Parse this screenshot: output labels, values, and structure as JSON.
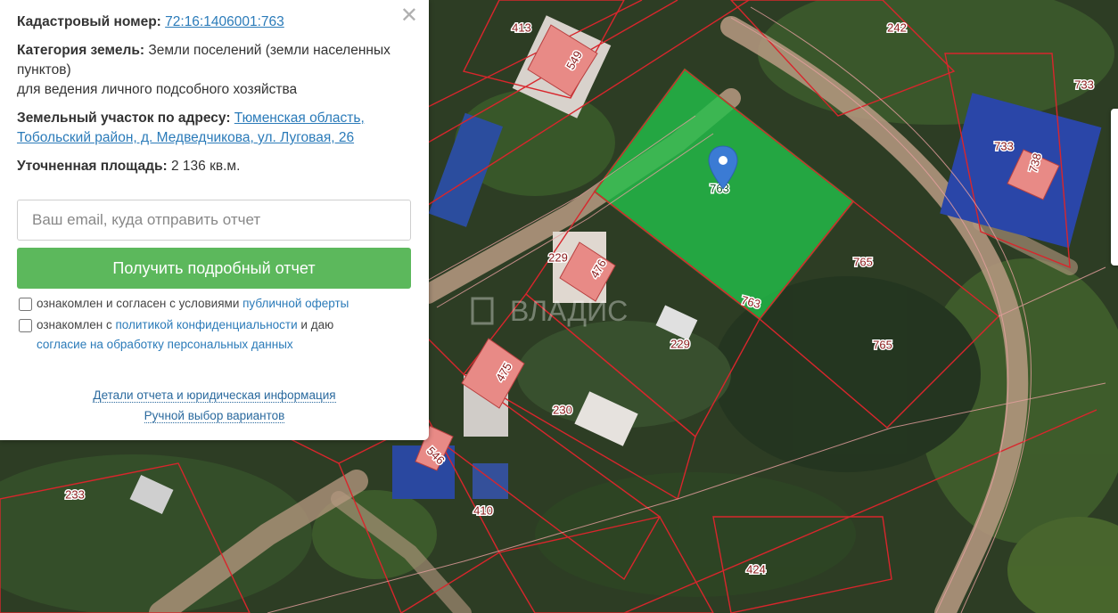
{
  "panel": {
    "close_glyph": "✕",
    "cadastral_label": "Кадастровый номер:",
    "cadastral_number": "72:16:1406001:763",
    "category_label": "Категория земель:",
    "category_value": "Земли поселений (земли населенных пунктов)",
    "category_use": "для ведения личного подсобного хозяйства",
    "address_label": "Земельный участок по адресу:",
    "address_value": "Тюменская область, Тобольский район, д. Медведчикова, ул. Луговая, 26",
    "area_label": "Уточненная площадь:",
    "area_value": "2 136 кв.м.",
    "email_placeholder": "Ваш email, куда отправить отчет",
    "email_value": "",
    "report_button": "Получить подробный отчет",
    "consent1_text": "ознакомлен и согласен с условиями",
    "consent1_link": "публичной оферты",
    "consent2_text": "ознакомлен с",
    "consent2_link": "политикой конфиденциальности",
    "consent2_mid": "и даю",
    "consent2_link2": "согласие на обработку персональных данных",
    "details_link": "Детали отчета и юридическая информация",
    "manual_link": "Ручной выбор вариантов"
  },
  "map": {
    "watermark": "ВЛАДИС",
    "selected_parcel": "763",
    "parcel_labels": [
      "413",
      "549",
      "242",
      "733",
      "733",
      "738",
      "229",
      "476",
      "765",
      "763",
      "229",
      "765",
      "475",
      "230",
      "546",
      "233",
      "410",
      "424"
    ],
    "colors": {
      "selected_fill": "#22c14a",
      "boundary": "#d8262c",
      "building": "#e88a86",
      "marker": "#3b7bd4"
    }
  }
}
